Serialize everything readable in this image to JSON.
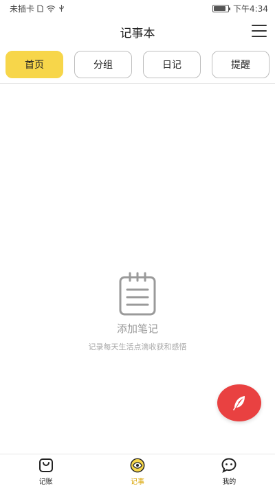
{
  "status_bar": {
    "carrier": "未插卡",
    "time": "下午4:34",
    "battery_level": 0.85
  },
  "header": {
    "title": "记事本",
    "menu_icon": "hamburger-menu-icon"
  },
  "tabs": [
    {
      "label": "首页",
      "active": true
    },
    {
      "label": "分组",
      "active": false
    },
    {
      "label": "日记",
      "active": false
    },
    {
      "label": "提醒",
      "active": false
    }
  ],
  "empty_state": {
    "icon": "notepad-icon",
    "title": "添加笔记",
    "subtitle": "记录每天生活点滴收获和感悟"
  },
  "fab": {
    "icon": "feather-icon",
    "color": "#e94141"
  },
  "bottom_nav": [
    {
      "label": "记账",
      "icon": "shopping-bag-icon",
      "active": false
    },
    {
      "label": "记事",
      "icon": "eye-icon",
      "active": true
    },
    {
      "label": "我的",
      "icon": "chat-face-icon",
      "active": false
    }
  ],
  "colors": {
    "accent": "#f7d64a",
    "active_nav": "#d9a400",
    "fab": "#e94141"
  }
}
